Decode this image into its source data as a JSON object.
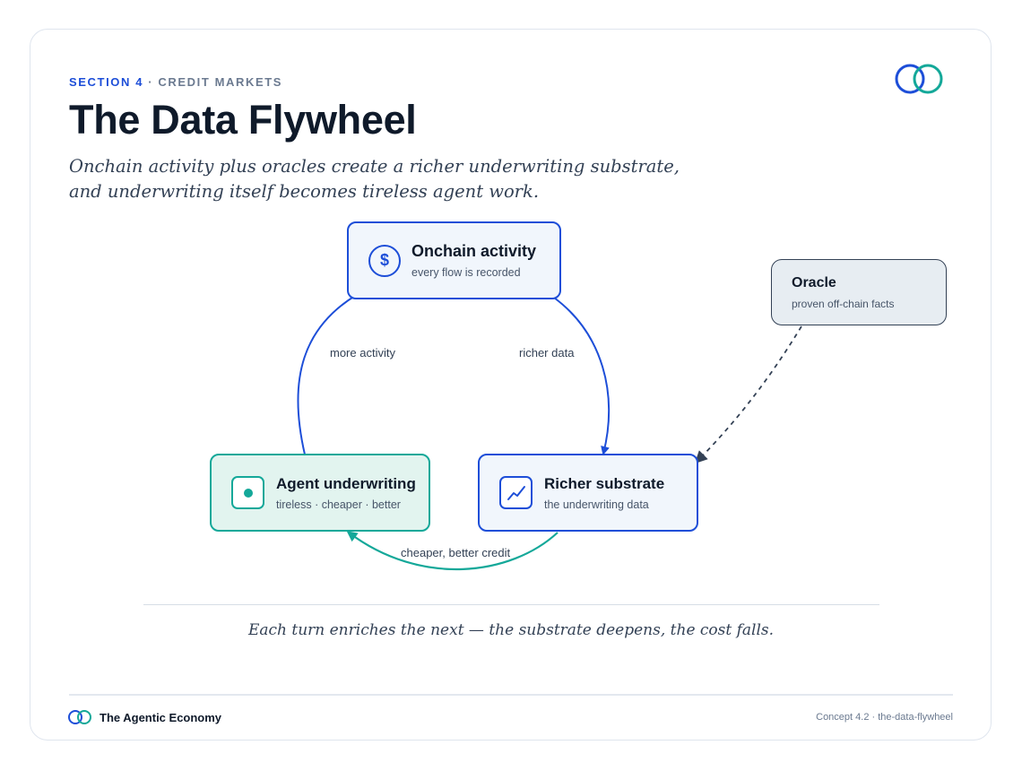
{
  "header": {
    "section_label": "SECTION 4",
    "section_topic": "· CREDIT MARKETS",
    "title": "The Data Flywheel",
    "subtitle_line1": "Onchain activity plus oracles create a richer underwriting substrate,",
    "subtitle_line2": "and underwriting itself becomes tireless agent work."
  },
  "diagram": {
    "nodes": {
      "onchain": {
        "title": "Onchain activity",
        "subtitle": "every flow is recorded",
        "icon": "dollar-icon",
        "icon_glyph": "$"
      },
      "richer": {
        "title": "Richer substrate",
        "subtitle": "the underwriting data",
        "icon": "trend-chart-icon"
      },
      "agent": {
        "title": "Agent underwriting",
        "subtitle": "tireless · cheaper · better",
        "icon": "dot-icon"
      },
      "oracle": {
        "title": "Oracle",
        "subtitle": "proven off-chain facts"
      }
    },
    "edges": {
      "more_activity": "more activity",
      "richer_data": "richer data",
      "cheaper_credit": "cheaper, better credit"
    }
  },
  "caption": "Each turn enriches the next — the substrate deepens, the cost falls.",
  "footer": {
    "brand": "The Agentic Economy",
    "reference": "Concept 4.2 · the-data-flywheel"
  },
  "colors": {
    "blue": "#1d4ed8",
    "teal": "#14a899",
    "navy": "#0f1a2a",
    "slate": "#334155"
  }
}
